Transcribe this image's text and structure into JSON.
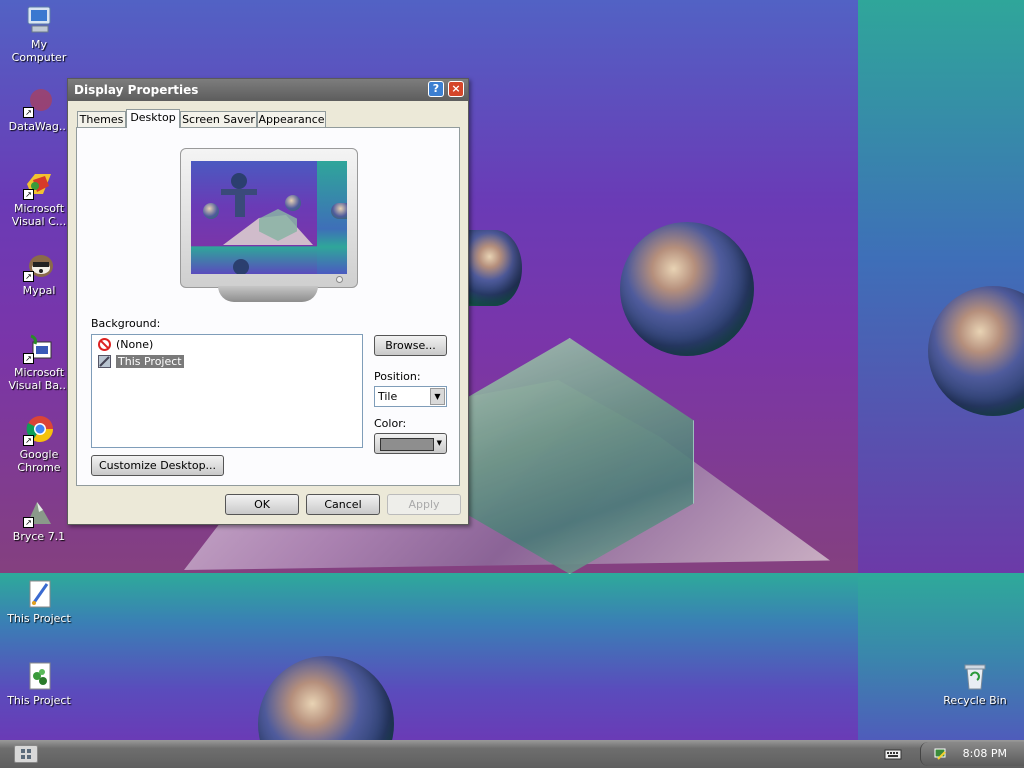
{
  "desktop": {
    "icons": [
      {
        "label": "My\nComputer",
        "icon": "my-computer-icon"
      },
      {
        "label": "DataWag...",
        "icon": "datawag-icon",
        "shortcut": true
      },
      {
        "label": "Microsoft\nVisual C...",
        "icon": "visual-c-icon",
        "shortcut": true
      },
      {
        "label": "Mypal",
        "icon": "mypal-icon",
        "shortcut": true
      },
      {
        "label": "Microsoft\nVisual Ba...",
        "icon": "visual-basic-icon",
        "shortcut": true
      },
      {
        "label": "Google\nChrome",
        "icon": "chrome-icon",
        "shortcut": true
      },
      {
        "label": "Bryce 7.1",
        "icon": "bryce-icon",
        "shortcut": true
      },
      {
        "label": "This Project",
        "icon": "paint-file-icon"
      },
      {
        "label": "This Project",
        "icon": "project-file-icon"
      },
      {
        "label": "Recycle Bin",
        "icon": "recycle-bin-icon"
      }
    ]
  },
  "dialog": {
    "title": "Display Properties",
    "help_glyph": "?",
    "close_glyph": "×",
    "tabs": [
      "Themes",
      "Desktop",
      "Screen Saver",
      "Appearance"
    ],
    "active_tab": "Desktop",
    "background_label": "Background:",
    "background_items": [
      {
        "label": "(None)",
        "icon": "no-entry-icon",
        "selected": false
      },
      {
        "label": "This Project",
        "icon": "image-file-icon",
        "selected": true
      }
    ],
    "browse_label": "Browse...",
    "position_label": "Position:",
    "position_value": "Tile",
    "color_label": "Color:",
    "color_value": "#8e8e8e",
    "customize_label": "Customize Desktop...",
    "ok_label": "OK",
    "cancel_label": "Cancel",
    "apply_label": "Apply"
  },
  "taskbar": {
    "clock": "8:08 PM"
  }
}
